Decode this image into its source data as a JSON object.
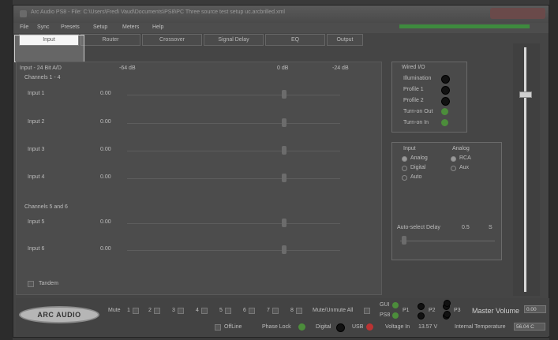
{
  "window": {
    "title": "Arc Audio PS8 - File: C:\\Users\\Fred\\ Vaud\\Documents\\PS8\\PC Three source test setup uc.arcbrilled.xml",
    "colors": {
      "background": "#454545",
      "status_green": "#3e8a3e",
      "led_green": "#4c8d3b",
      "led_red": "#b33333",
      "highlight": "#f4f4f4"
    }
  },
  "menu": {
    "items": [
      "File",
      "Sync",
      "Presets",
      "Setup",
      "Meters",
      "Help"
    ]
  },
  "tabs": [
    "Input",
    "Router",
    "Crossover",
    "Signal Delay",
    "EQ",
    "Output"
  ],
  "active_tab": "Input",
  "input_panel": {
    "header": "Input - 24 Bit A/D",
    "scale_left": "-64 dB",
    "scale_mid": "0 dB",
    "scale_right": "-24 dB",
    "group1_label": "Channels 1 - 4",
    "group2_label": "Channels 5 and 6",
    "channels": [
      {
        "label": "Input 1",
        "value": "0.00"
      },
      {
        "label": "Input 2",
        "value": "0.00"
      },
      {
        "label": "Input 3",
        "value": "0.00"
      },
      {
        "label": "Input 4",
        "value": "0.00"
      },
      {
        "label": "Input 5",
        "value": "0.00"
      },
      {
        "label": "Input 6",
        "value": "0.00"
      }
    ],
    "tandem_label": "Tandem"
  },
  "wired_io": {
    "title": "Wired I/O",
    "items": [
      {
        "label": "Illumination",
        "led": "black"
      },
      {
        "label": "Profile 1",
        "led": "black"
      },
      {
        "label": "Profile 2",
        "led": "black"
      },
      {
        "label": "Turn-on Out",
        "led": "green"
      },
      {
        "label": "Turn-on In",
        "led": "green"
      }
    ]
  },
  "input_select": {
    "input_title": "Input",
    "analog_title": "Analog",
    "input_options": [
      {
        "label": "Analog",
        "selected": true
      },
      {
        "label": "Digital",
        "selected": false
      },
      {
        "label": "Auto",
        "selected": false
      }
    ],
    "analog_options": [
      {
        "label": "RCA",
        "selected": true
      },
      {
        "label": "Aux",
        "selected": false
      }
    ],
    "autoselect_label": "Auto-select Delay",
    "autoselect_value": "0.5",
    "autoselect_unit": "S"
  },
  "bottom": {
    "logo": "ARC AUDIO",
    "mute_label": "Mute",
    "mute_channels": [
      "1",
      "2",
      "3",
      "4",
      "5",
      "6",
      "7",
      "8"
    ],
    "mute_all_label": "Mute/Unmute All",
    "gui_label": "GUI",
    "ps8_label": "PS8",
    "presets": [
      "P1",
      "P2",
      "P3"
    ],
    "master_volume_label": "Master Volume",
    "master_volume_value": "0.00",
    "offline_label": "OffLine",
    "phase_lock_label": "Phase Lock",
    "digital_label": "Digital",
    "usb_label": "USB",
    "voltage_label": "Voltage In",
    "voltage_value": "13.57 V",
    "temp_label": "Internal Temperature",
    "temp_value": "56.04 C"
  }
}
